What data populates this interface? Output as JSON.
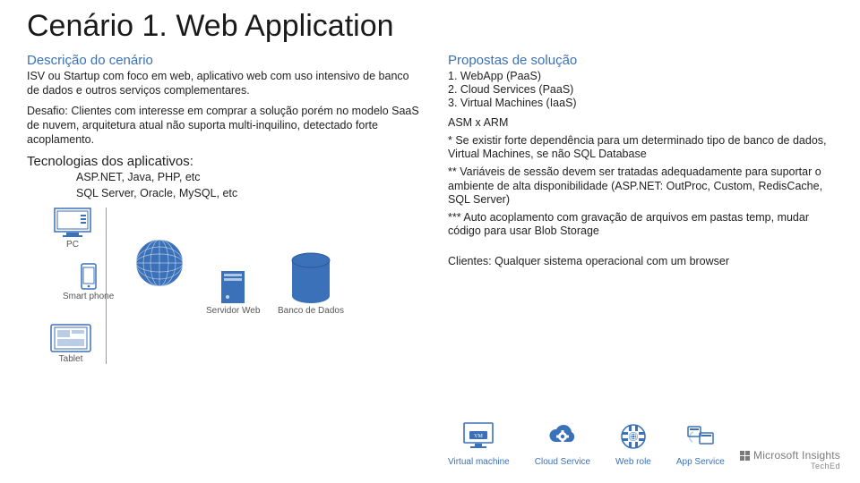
{
  "title": "Cenário 1. Web Application",
  "left": {
    "desc_head": "Descrição do cenário",
    "desc_body": "ISV ou Startup com foco em web, aplicativo web com uso intensivo de banco de dados e outros serviços complementares.",
    "challenge": "Desafio: Clientes com interesse em comprar a solução porém no modelo SaaS de nuvem, arquitetura atual não suporta multi-inquilino, detectado forte acoplamento.",
    "tech_head": "Tecnologias dos aplicativos:",
    "tech_line1": "ASP.NET, Java, PHP, etc",
    "tech_line2": "SQL Server, Oracle, MySQL, etc"
  },
  "right": {
    "prop_head": "Propostas de solução",
    "items": {
      "0": "1.   WebApp (PaaS)",
      "1": "2.   Cloud Services (PaaS)",
      "2": "3.   Virtual Machines (IaaS)"
    },
    "asm": "ASM x ARM",
    "n1": "* Se existir forte dependência para um determinado tipo de banco de dados, Virtual Machines, se não SQL Database",
    "n2": "** Variáveis de sessão devem ser tratadas adequadamente para suportar o ambiente de alta disponibilidade (ASP.NET: OutProc, Custom, RedisCache, SQL Server)",
    "n3": "*** Auto acoplamento com gravação de arquivos em pastas temp, mudar código para usar Blob Storage",
    "clients": "Clientes: Qualquer sistema operacional com um browser"
  },
  "diagram": {
    "pc": "PC",
    "phone": "Smart phone",
    "tablet": "Tablet",
    "web": "Servidor Web",
    "db": "Banco de Dados"
  },
  "azure": {
    "vm_badge": "VM",
    "vm": "Virtual machine",
    "cs": "Cloud Service",
    "wr": "Web role",
    "as": "App Service"
  },
  "footer": {
    "brand": "Microsoft",
    "product": "Insights",
    "sub": "TechEd"
  }
}
